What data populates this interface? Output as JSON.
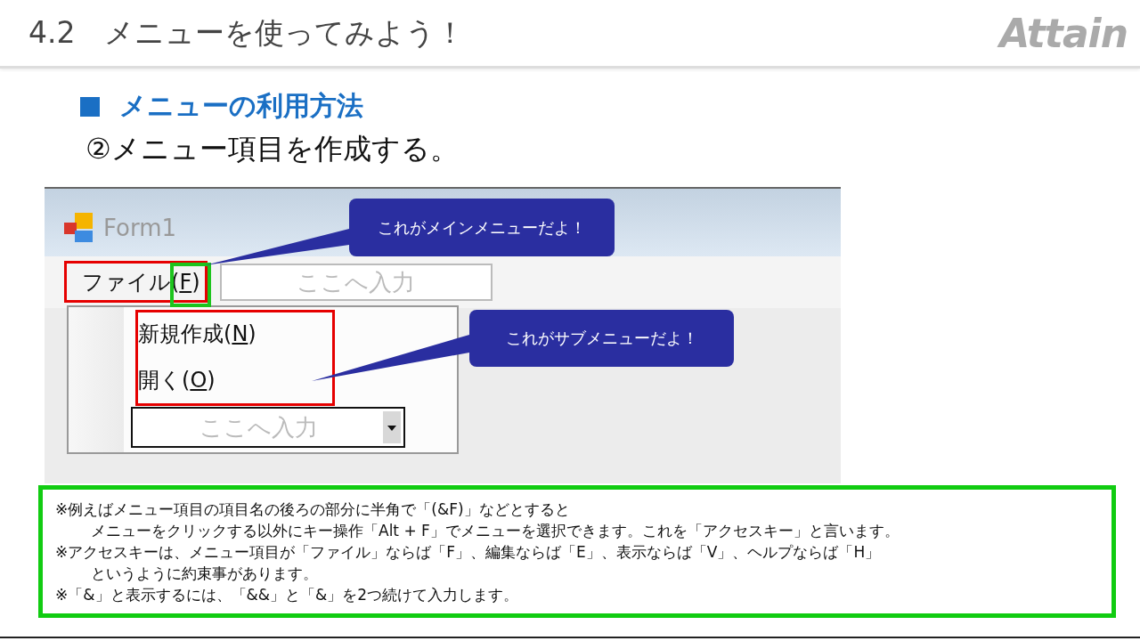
{
  "header": {
    "title": "4.2　メニューを使ってみよう！",
    "logo": "Attain"
  },
  "section": {
    "heading": "メニューの利用方法",
    "step": "②メニュー項目を作成する。"
  },
  "form": {
    "title": "Form1",
    "menu_item": {
      "before": "ファイル(",
      "access_key": "F",
      "after": ")"
    },
    "menu_new": {
      "placeholder": "ここへ入力"
    },
    "submenu": [
      {
        "before": "新規作成(",
        "access_key": "N",
        "after": ")"
      },
      {
        "before": "開く(",
        "access_key": "O",
        "after": ")"
      }
    ],
    "submenu_new": {
      "placeholder": "ここへ入力"
    }
  },
  "callouts": [
    {
      "text": "これがメインメニューだよ！"
    },
    {
      "text": "これがサブメニューだよ！"
    }
  ],
  "notes": [
    {
      "kind": "mark",
      "text": "※例えばメニュー項目の項目名の後ろの部分に半角で「(&F)」などとすると"
    },
    {
      "kind": "continued",
      "text": "メニューをクリックする以外にキー操作「Alt + F」でメニューを選択できます。これを「アクセスキー」と言います。"
    },
    {
      "kind": "mark",
      "text": "※アクセスキーは、メニュー項目が「ファイル」ならば「F」、編集ならば「E」、表示ならば「V」、ヘルプならば「H」"
    },
    {
      "kind": "continued",
      "text": "というように約束事があります。"
    },
    {
      "kind": "mark",
      "text": "※「&」と表示するには、「&&」と「&」を2つ続けて入力します。"
    }
  ]
}
